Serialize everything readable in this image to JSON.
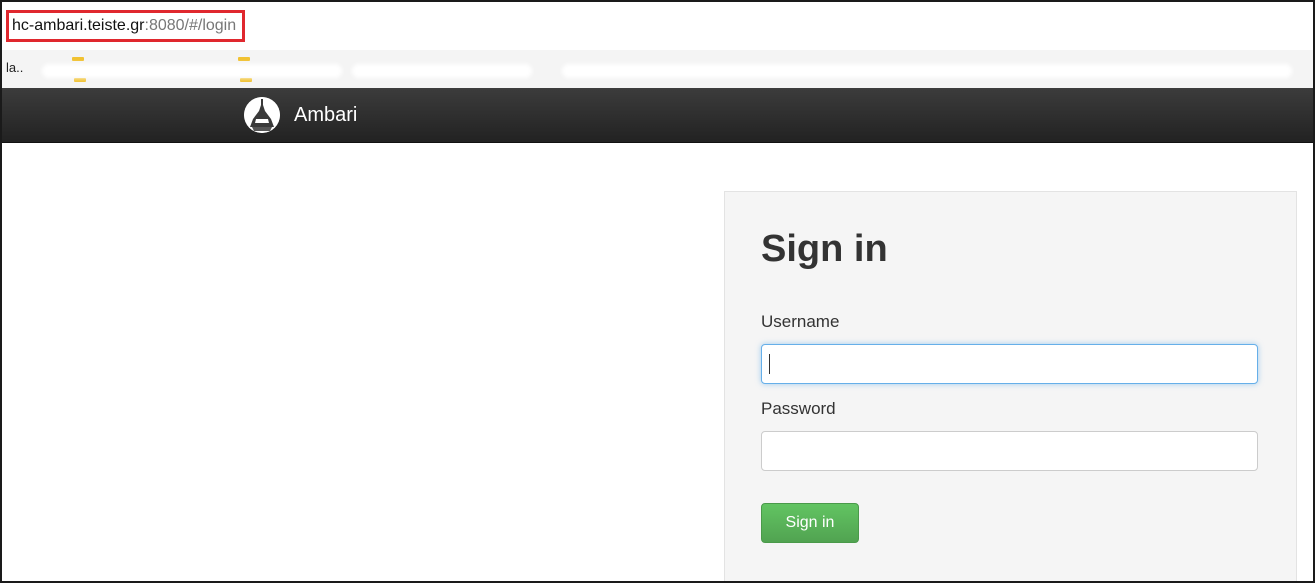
{
  "browser": {
    "url_host": "hc-ambari.teiste.gr",
    "url_rest": ":8080/#/login",
    "bookmark_text": "la..",
    "highlight_color": "#e0282e"
  },
  "navbar": {
    "brand_name": "Ambari",
    "logo_icon": "ambari-logo-icon",
    "background": "#2a2a2a"
  },
  "login": {
    "title": "Sign in",
    "username_label": "Username",
    "username_value": "",
    "password_label": "Password",
    "password_value": "",
    "submit_label": "Sign in",
    "submit_color": "#5bb75b"
  }
}
